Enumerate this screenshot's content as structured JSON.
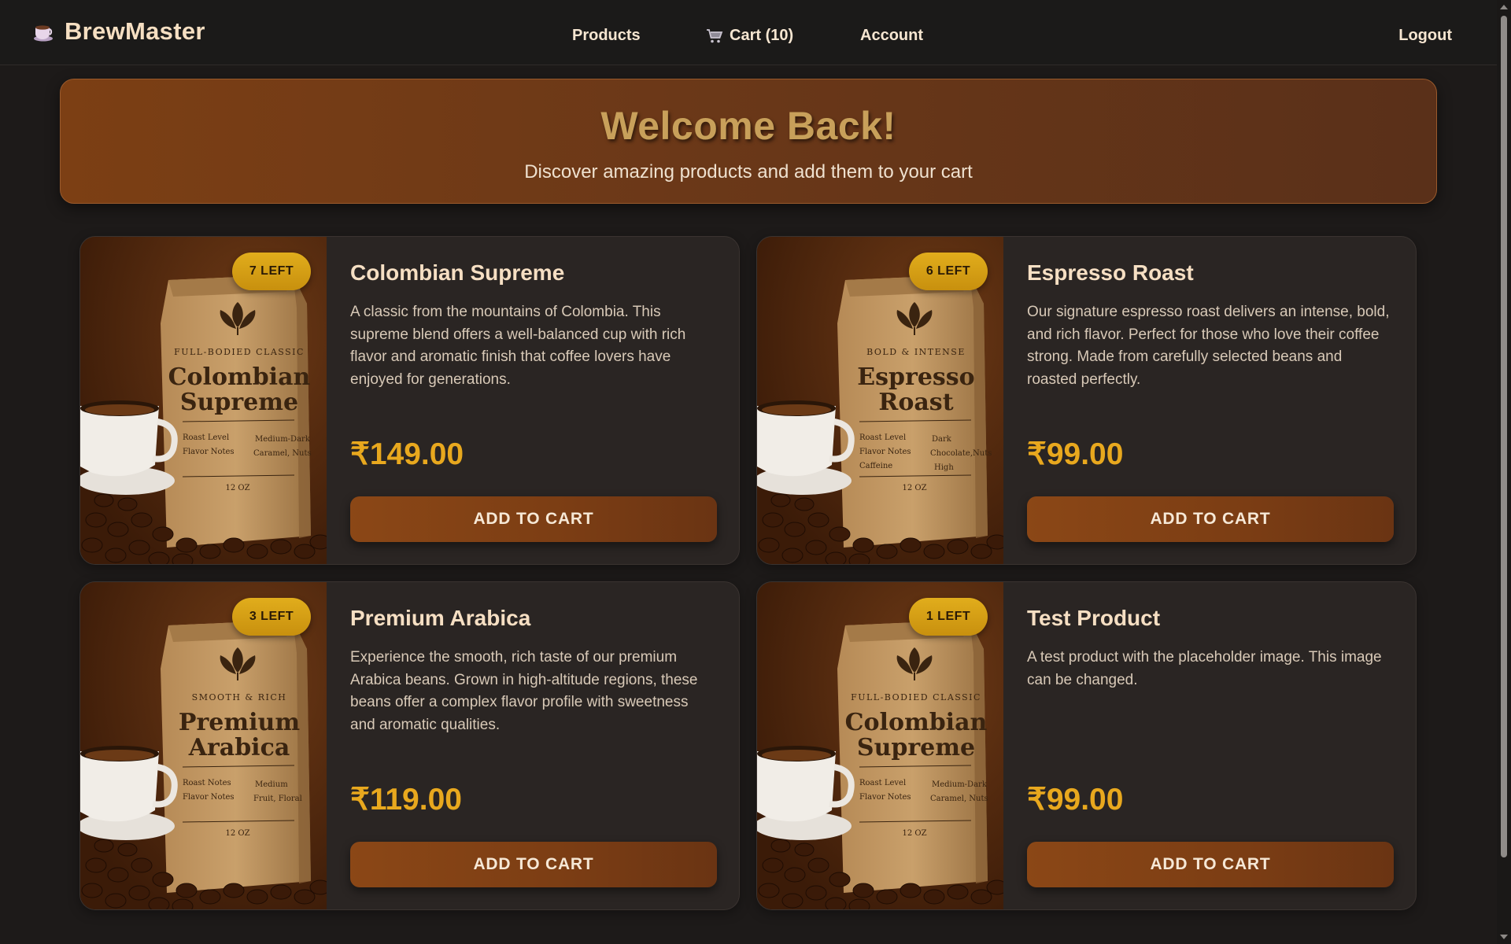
{
  "brand": {
    "name": "BrewMaster",
    "icon": "coffee-cup-icon"
  },
  "nav": {
    "products": "Products",
    "cart": "Cart (10)",
    "account": "Account",
    "logout": "Logout"
  },
  "hero": {
    "title": "Welcome Back!",
    "subtitle": "Discover amazing products and add them to your cart"
  },
  "products": [
    {
      "name": "Colombian Supreme",
      "stock": "7 LEFT",
      "description": "A classic from the mountains of Colombia. This supreme blend offers a well-balanced cup with rich flavor and aromatic finish that coffee lovers have enjoyed for generations.",
      "price": "₹149.00",
      "button": "ADD TO CART",
      "bag": {
        "tagline": "FULL-BODIED CLASSIC",
        "line1": "Colombian",
        "line2": "Supreme",
        "row1a": "Roast Level",
        "row1b": "Medium-Dark",
        "row2a": "Flavor Notes",
        "row2b": "Caramel, Nuts",
        "row3a": "",
        "row3b": "",
        "size": "12 OZ"
      }
    },
    {
      "name": "Espresso Roast",
      "stock": "6 LEFT",
      "description": "Our signature espresso roast delivers an intense, bold, and rich flavor. Perfect for those who love their coffee strong. Made from carefully selected beans and roasted perfectly.",
      "price": "₹99.00",
      "button": "ADD TO CART",
      "bag": {
        "tagline": "BOLD & INTENSE",
        "line1": "Espresso",
        "line2": "Roast",
        "row1a": "Roast Level",
        "row1b": "Dark",
        "row2a": "Flavor Notes",
        "row2b": "Chocolate,Nuts",
        "row3a": "Caffeine",
        "row3b": "High",
        "size": "12 OZ"
      }
    },
    {
      "name": "Premium Arabica",
      "stock": "3 LEFT",
      "description": "Experience the smooth, rich taste of our premium Arabica beans. Grown in high-altitude regions, these beans offer a complex flavor profile with sweetness and aromatic qualities.",
      "price": "₹119.00",
      "button": "ADD TO CART",
      "bag": {
        "tagline": "SMOOTH & RICH",
        "line1": "Premium",
        "line2": "Arabica",
        "row1a": "Roast Notes",
        "row1b": "Medium",
        "row2a": "Flavor Notes",
        "row2b": "Fruit, Floral",
        "row3a": "",
        "row3b": "",
        "size": "12 OZ"
      }
    },
    {
      "name": "Test Product",
      "stock": "1 LEFT",
      "description": "A test product with the placeholder image. This image can be changed.",
      "price": "₹99.00",
      "button": "ADD TO CART",
      "bag": {
        "tagline": "FULL-BODIED CLASSIC",
        "line1": "Colombian",
        "line2": "Supreme",
        "row1a": "Roast Level",
        "row1b": "Medium-Dark",
        "row2a": "Flavor Notes",
        "row2b": "Caramel, Nuts",
        "row3a": "",
        "row3b": "",
        "size": "12 OZ"
      }
    }
  ],
  "colors": {
    "accent": "#e8a81e",
    "hero_brown": "#7c3f14",
    "button_brown": "#8b4716",
    "badge_gold": "#e1ad1c",
    "background": "#1d1a19",
    "card": "#2a2523"
  }
}
